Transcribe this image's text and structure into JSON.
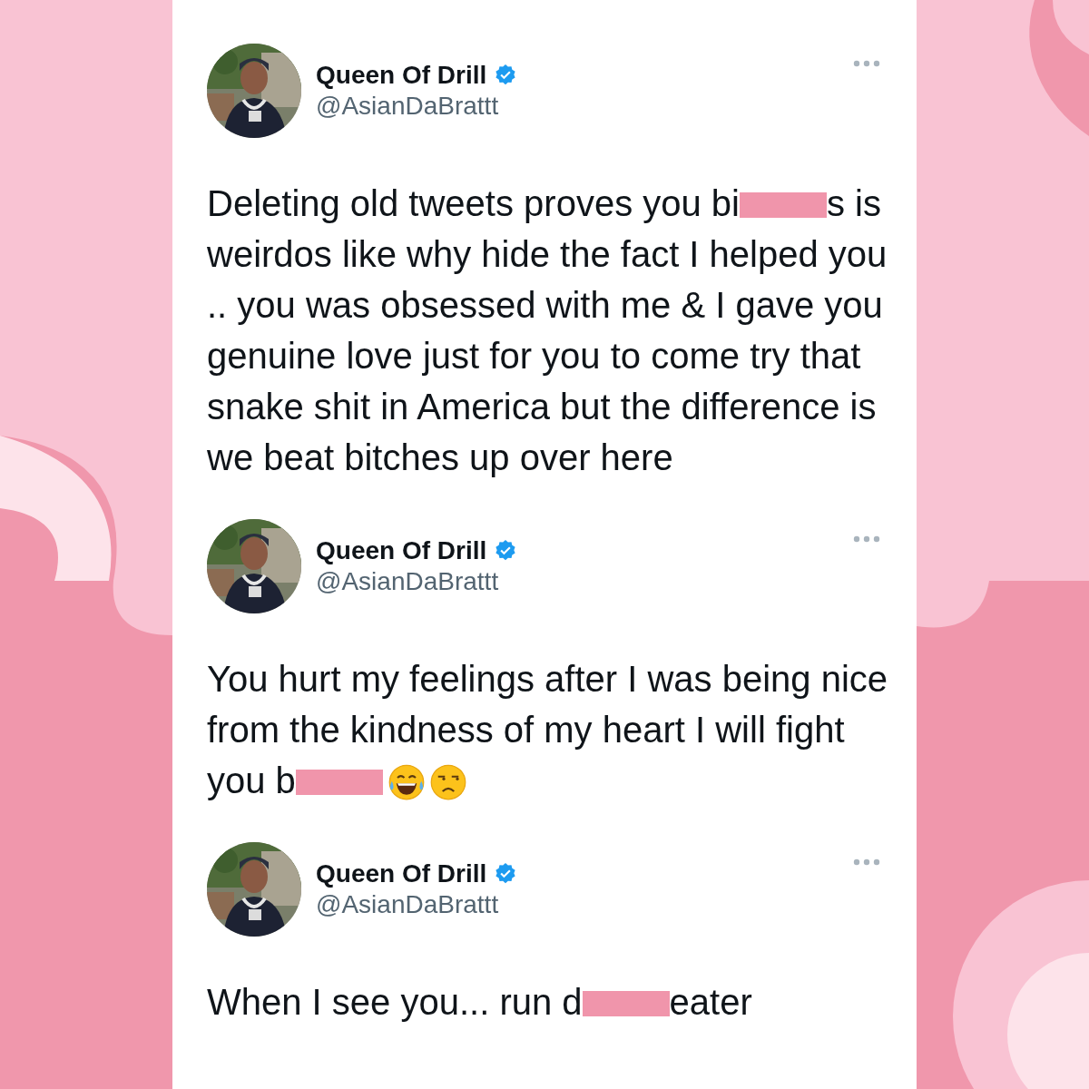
{
  "tweets": [
    {
      "author": {
        "name": "Queen Of Drill",
        "handle": "@AsianDaBrattt",
        "verified": true
      },
      "body": [
        {
          "kind": "text",
          "text": "Deleting old tweets proves you bi"
        },
        {
          "kind": "redaction"
        },
        {
          "kind": "text",
          "text": "s is weirdos like why hide the fact I helped you .. you was obsessed with me & I gave you genuine love just for you to come try that snake shit in America but the difference is we beat bitches up over here"
        }
      ]
    },
    {
      "author": {
        "name": "Queen Of Drill",
        "handle": "@AsianDaBrattt",
        "verified": true
      },
      "body": [
        {
          "kind": "text",
          "text": "You hurt my feelings after I was being nice from the kindness of my heart I will fight you b"
        },
        {
          "kind": "redaction"
        },
        {
          "kind": "emoji-laugh"
        },
        {
          "kind": "emoji-unamused"
        }
      ]
    },
    {
      "author": {
        "name": "Queen Of Drill",
        "handle": "@AsianDaBrattt",
        "verified": true
      },
      "body": [
        {
          "kind": "text",
          "text": "When I see you... run d"
        },
        {
          "kind": "redaction"
        },
        {
          "kind": "text",
          "text": "eater"
        }
      ]
    }
  ]
}
